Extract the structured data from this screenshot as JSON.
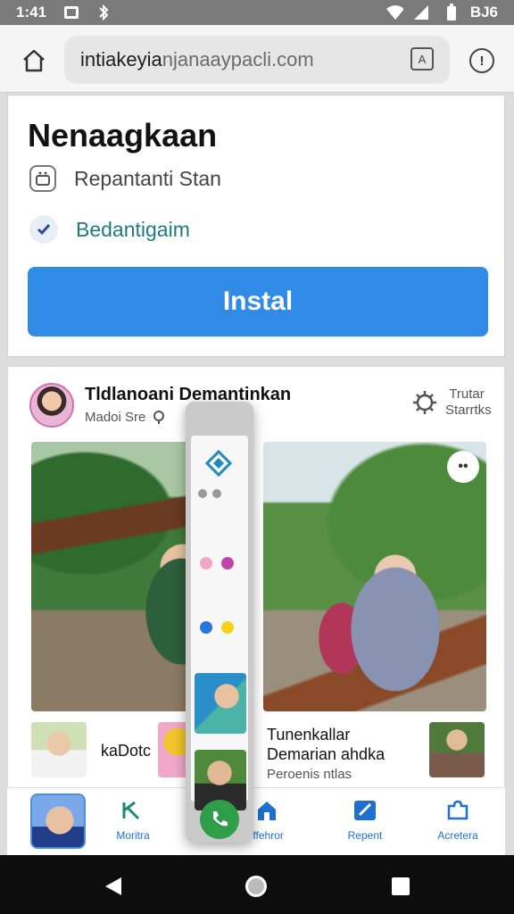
{
  "status_bar": {
    "time": "1:41",
    "battery_text": "BJ6",
    "icons": [
      "app-notification-icon",
      "bluetooth-icon",
      "wifi-icon",
      "signal-icon",
      "battery-icon"
    ]
  },
  "browser": {
    "url_dark": "intiakeyia",
    "url_light": "njanaaypacli.com",
    "tab_label": "A",
    "info_symbol": "!"
  },
  "install_card": {
    "title": "Nenaagkaan",
    "permission_1": "Repantanti Stan",
    "permission_2": "Bedantigaim",
    "install_label": "Instal",
    "colors": {
      "button": "#2f8be6",
      "accent_text": "#1e7a82"
    }
  },
  "post": {
    "author": "Tldlanoani Demantinkan",
    "meta": "Madoi Sre",
    "stats_label": "Trutar Starrtks",
    "more_label": "••",
    "row_left_label": "kaDotc",
    "row_right_title": "Tunenkallar",
    "row_right_subtitle": "Demarian ahdka",
    "row_right_meta": "Peroenis ntlas"
  },
  "bottom_nav": {
    "items": [
      {
        "label": "Moritra",
        "icon": "check-pen-icon"
      },
      {
        "label": "Iffehror",
        "icon": "home-icon"
      },
      {
        "label": "Repent",
        "icon": "edit-icon"
      },
      {
        "label": "Acretera",
        "icon": "puzzle-icon"
      }
    ]
  }
}
